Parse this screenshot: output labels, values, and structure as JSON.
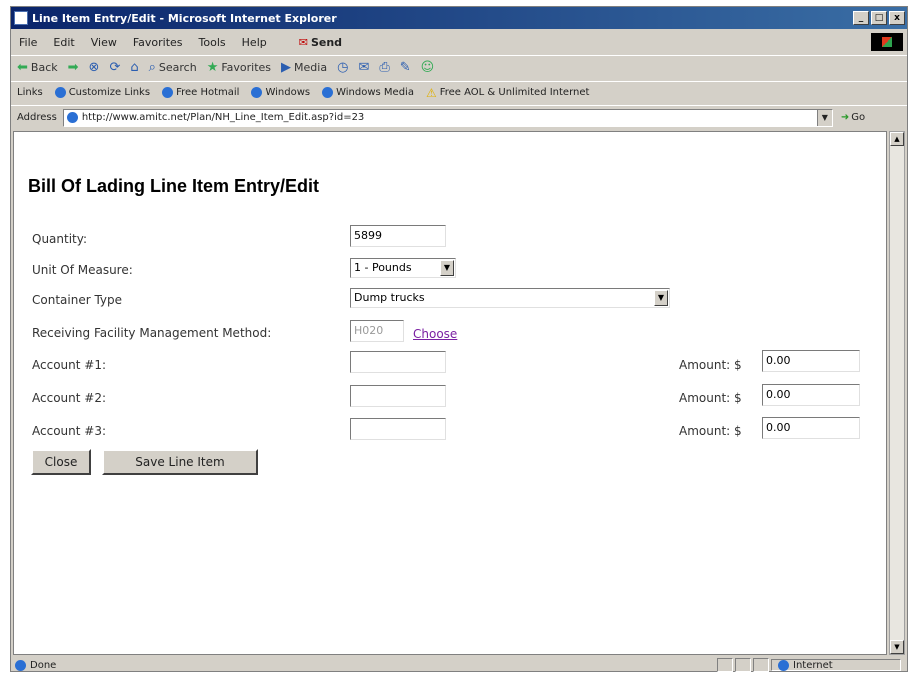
{
  "window": {
    "title": "Line Item Entry/Edit - Microsoft Internet Explorer",
    "controls": [
      "_",
      "□",
      "x"
    ]
  },
  "menu": {
    "items": [
      "File",
      "Edit",
      "View",
      "Favorites",
      "Tools",
      "Help"
    ],
    "send": "Send"
  },
  "toolbar": {
    "back": "Back",
    "search": "Search",
    "favorites": "Favorites",
    "media": "Media"
  },
  "links": {
    "label": "Links",
    "items": [
      "Customize Links",
      "Free Hotmail",
      "Windows",
      "Windows Media",
      "Free AOL & Unlimited Internet"
    ]
  },
  "address": {
    "label": "Address",
    "url": "http://www.amitc.net/Plan/NH_Line_Item_Edit.asp?id=23",
    "go": "Go"
  },
  "form": {
    "title": "Bill Of Lading Line Item Entry/Edit",
    "quantity_label": "Quantity:",
    "quantity_value": "5899",
    "uom_label": "Unit Of Measure:",
    "uom_value": "1 - Pounds",
    "container_label": "Container Type",
    "container_value": "Dump trucks",
    "method_label": "Receiving Facility Management Method:",
    "method_value": "H020",
    "choose": "Choose",
    "account1_label": "Account #1:",
    "account2_label": "Account #2:",
    "account3_label": "Account #3:",
    "account1_value": "",
    "account2_value": "",
    "account3_value": "",
    "amount_label": "Amount: $",
    "amount1": "0.00",
    "amount2": "0.00",
    "amount3": "0.00",
    "close_button": "Close",
    "save_button": "Save Line Item"
  },
  "status": {
    "text": "Done",
    "zone": "Internet"
  }
}
